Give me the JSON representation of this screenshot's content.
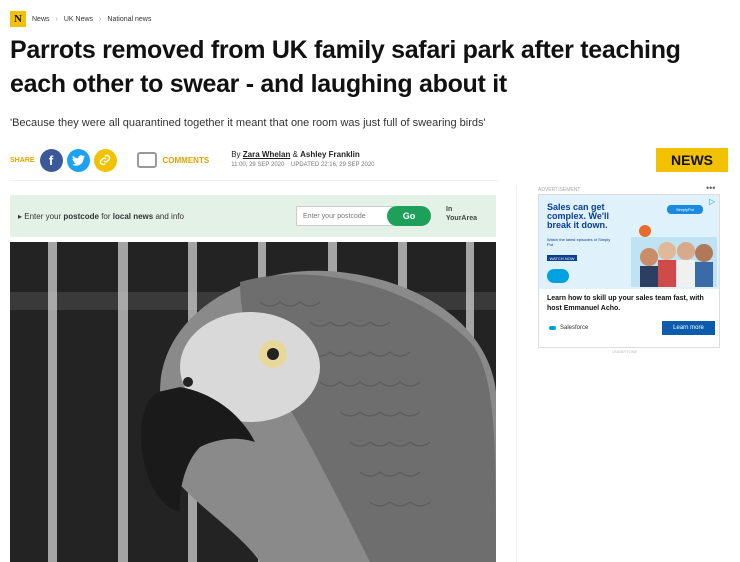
{
  "breadcrumb": {
    "logo": "N",
    "items": [
      "News",
      "UK News",
      "National news"
    ]
  },
  "article": {
    "headline": "Parrots removed from UK family safari park after teaching each other to swear - and laughing about it",
    "standfirst": "'Because they were all quarantined together it meant that one room was just full of swearing birds'",
    "share_label": "SHARE",
    "comments_label": "COMMENTS",
    "by_prefix": "By",
    "author1": "Zara Whelan",
    "amp": "&",
    "author2": "Ashley Franklin",
    "published": "11:00, 29 SEP 2020",
    "updated": "UPDATED 22:16, 29 SEP 2020",
    "section_badge": "NEWS"
  },
  "postcode": {
    "prompt_pre": "Enter your",
    "prompt_b1": "postcode",
    "prompt_mid": "for",
    "prompt_b2": "local news",
    "prompt_post": "and info",
    "placeholder": "Enter your postcode",
    "button": "Go",
    "partner_line1": "In",
    "partner_line2": "YourArea"
  },
  "ad": {
    "label": "ADVERTISEMENT",
    "headline": "Sales can get complex. We'll break it down.",
    "sub": "Watch the latest episodes of Simply Put",
    "watch": "WATCH NOW",
    "simply": "SimplyPut",
    "body": "Learn how to skill up your sales team fast, with host Emmanuel Acho.",
    "brand": "Salesforce",
    "cta": "Learn more",
    "footer": "UNDERTONE"
  },
  "colors": {
    "accent": "#f2c200",
    "share_fb": "#3b5998",
    "share_tw": "#1da1f2",
    "go": "#1fa05a"
  }
}
